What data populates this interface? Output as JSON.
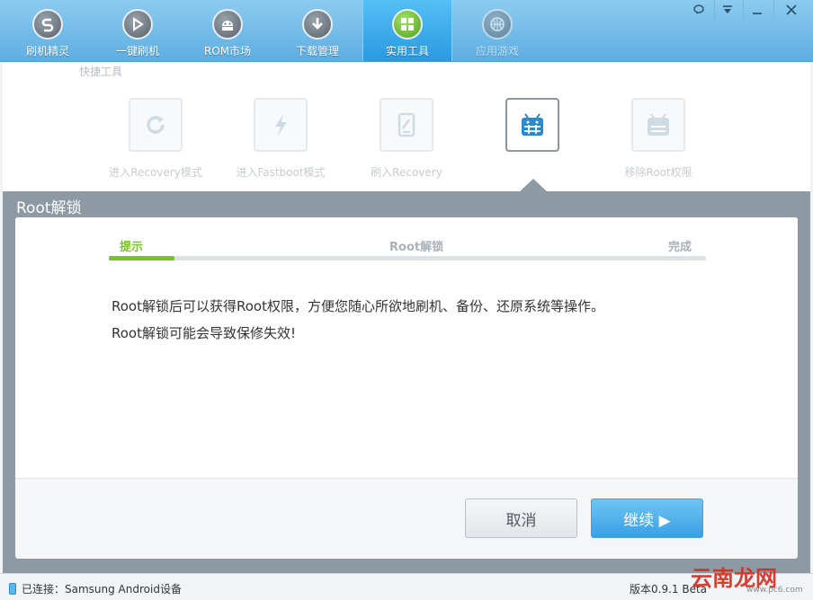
{
  "nav": {
    "tabs": [
      {
        "label": "刷机精灵",
        "icon": "flash-wizard-icon"
      },
      {
        "label": "一键刷机",
        "icon": "play-icon"
      },
      {
        "label": "ROM市场",
        "icon": "android-icon"
      },
      {
        "label": "下载管理",
        "icon": "download-icon"
      },
      {
        "label": "实用工具",
        "icon": "grid-tools-icon",
        "active": true
      },
      {
        "label": "应用游戏",
        "icon": "basketball-icon"
      }
    ],
    "window_controls": {
      "feedback": "◯",
      "menu": "≡",
      "minimize": "—",
      "close": "✕"
    }
  },
  "quick_tools": {
    "title": "快捷工具",
    "items": [
      {
        "label": "进入Recovery模式",
        "icon": "refresh-icon"
      },
      {
        "label": "进入Fastboot模式",
        "icon": "lightning-icon"
      },
      {
        "label": "刷入Recovery",
        "icon": "tablet-icon"
      },
      {
        "label": "",
        "icon": "android-unlock-icon",
        "selected": true
      },
      {
        "label": "移除Root权限",
        "icon": "android-remove-icon"
      }
    ]
  },
  "panel": {
    "title": "Root解锁",
    "steps": [
      "提示",
      "Root解锁",
      "完成"
    ],
    "progress": 0.11,
    "message_line1": "Root解锁后可以获得Root权限，方便您随心所欲地刷机、备份、还原系统等操作。",
    "message_line2": "Root解锁可能会导致保修失效!",
    "cancel_label": "取消",
    "continue_label": "继续 ▶"
  },
  "status": {
    "connection": "已连接：Samsung Android设备",
    "version": "版本0.9.1 Beta"
  },
  "watermark": {
    "text": "云南龙网",
    "sub": "www.pc6.com"
  },
  "colors": {
    "accent": "#3aa0e4",
    "progress": "#7cc12a",
    "active_tab": "#2a99e0"
  }
}
